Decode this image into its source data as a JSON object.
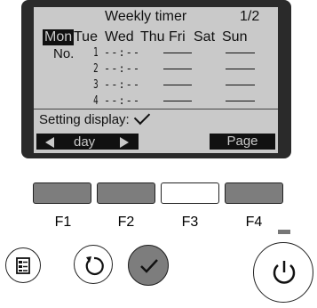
{
  "lcd": {
    "title": "Weekly timer",
    "page": "1/2",
    "days": [
      {
        "label": "Mon",
        "selected": true
      },
      {
        "label": "Tue",
        "selected": false
      },
      {
        "label": "Wed",
        "selected": false
      },
      {
        "label": "Thu",
        "selected": false
      },
      {
        "label": "Fri",
        "selected": false
      },
      {
        "label": "Sat",
        "selected": false
      },
      {
        "label": "Sun",
        "selected": false
      }
    ],
    "rows_label": "No.",
    "rows": [
      {
        "num": "1",
        "time": "--:--"
      },
      {
        "num": "2",
        "time": "--:--"
      },
      {
        "num": "3",
        "time": "--:--"
      },
      {
        "num": "4",
        "time": "--:--"
      }
    ],
    "setting_display_label": "Setting display:",
    "setting_display_icon": "check-icon",
    "day_control_label": "day",
    "page_button_label": "Page"
  },
  "function_keys": [
    {
      "label": "F1",
      "style": "gray"
    },
    {
      "label": "F2",
      "style": "gray"
    },
    {
      "label": "F3",
      "style": "white"
    },
    {
      "label": "F4",
      "style": "gray"
    }
  ],
  "buttons": {
    "menu_icon": "menu-icon",
    "return_icon": "return-icon",
    "confirm_icon": "check-icon",
    "power_icon": "power-icon"
  },
  "colors": {
    "lcd_background": "#c9c9c9",
    "bezel": "#2a2a2a",
    "key_gray": "#7d7d7d",
    "indicator": "#777777"
  }
}
